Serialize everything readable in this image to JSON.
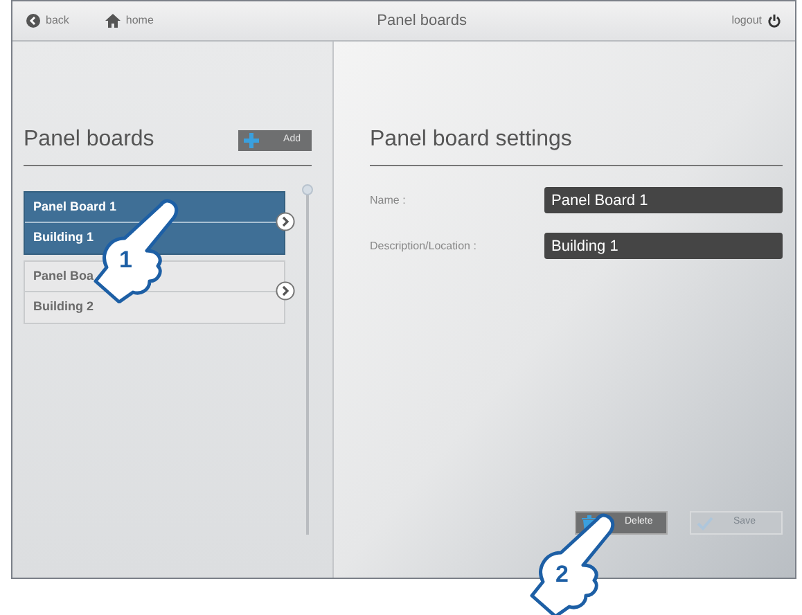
{
  "top_bar": {
    "back": "back",
    "home": "home",
    "title": "Panel boards",
    "logout": "logout"
  },
  "list": {
    "title": "Panel boards",
    "add_button": "Add",
    "items": [
      {
        "name": "Panel Board 1",
        "location": "Building 1",
        "selected": true
      },
      {
        "name": "Panel Boa",
        "location": "Building 2",
        "selected": false
      }
    ]
  },
  "settings": {
    "title": "Panel board settings",
    "fields": [
      {
        "label": "Name :",
        "value": "Panel Board 1"
      },
      {
        "label": "Description/Location :",
        "value": "Building 1"
      }
    ],
    "delete_button": {
      "label": "Delete",
      "disabled": false
    },
    "save_button": {
      "label": "Save",
      "disabled": true
    }
  },
  "callouts": [
    {
      "number": "1"
    },
    {
      "number": "2"
    }
  ]
}
